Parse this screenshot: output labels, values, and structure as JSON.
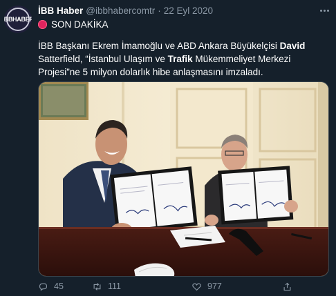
{
  "tweet": {
    "avatar_text": "İBBHABER",
    "display_name": "İBB Haber",
    "handle": "@ibbhabercomtr",
    "separator": "·",
    "date": "22 Eyl 2020",
    "badge_label": "SON DAKİKA",
    "text_parts": {
      "p1": "İBB Başkanı Ekrem İmamoğlu ve ABD Ankara Büyükelçisi ",
      "b1": "David",
      "p2": " Satterfield, “İstanbul Ulaşım ve ",
      "b2": "Trafik",
      "p3": " Mükemmeliyet Merkezi Projesi”ne 5 milyon dolarlık hibe anlaşmasını imzaladı."
    }
  },
  "actions": {
    "reply_count": "45",
    "retweet_count": "111",
    "like_count": "977"
  },
  "colors": {
    "background": "#15202b",
    "muted": "#8b98a5",
    "breaking_red": "#e0245e"
  },
  "icons": [
    "more-icon",
    "breaking-dot-icon",
    "reply-icon",
    "retweet-icon",
    "like-icon",
    "share-icon"
  ]
}
